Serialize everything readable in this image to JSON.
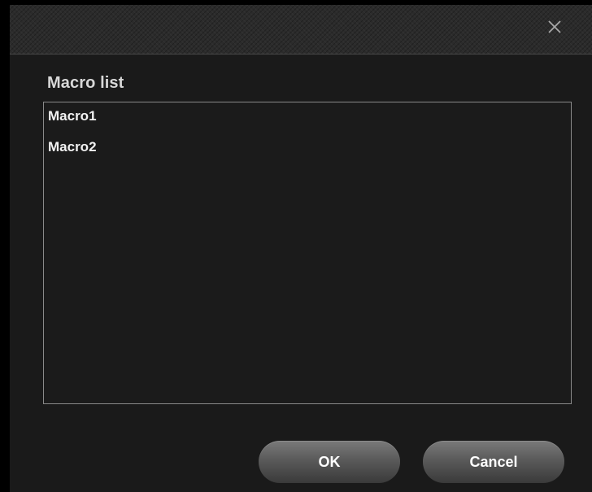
{
  "dialog": {
    "close_icon": "close-icon",
    "section_label": "Macro list",
    "macros": [
      {
        "label": "Macro1"
      },
      {
        "label": "Macro2"
      }
    ],
    "ok_label": "OK",
    "cancel_label": "Cancel"
  },
  "colors": {
    "background": "#1a1a1a",
    "titlebar": "#2b2b2b",
    "text": "#f2f2f2",
    "border": "#8a8a8a"
  }
}
